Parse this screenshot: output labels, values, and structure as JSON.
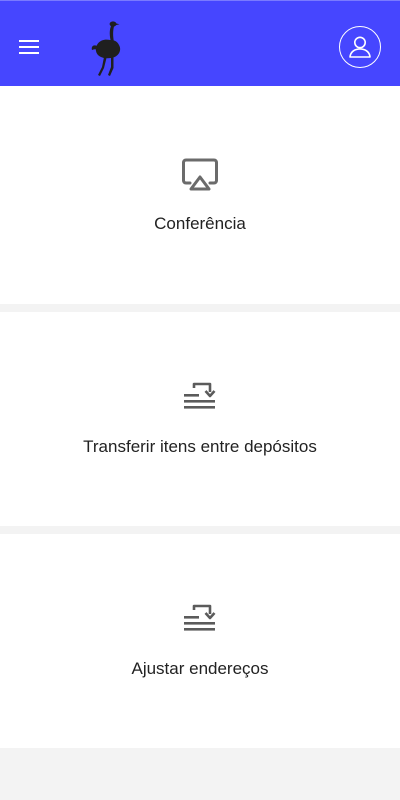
{
  "header": {
    "menu_icon": "hamburger-menu-icon",
    "logo_icon": "ostrich-logo-icon",
    "profile_icon": "user-profile-icon",
    "background_color": "#4646ff"
  },
  "menu": {
    "items": [
      {
        "label": "Conferência",
        "icon": "airplay-icon"
      },
      {
        "label": "Transferir itens entre depósitos",
        "icon": "transfer-list-icon"
      },
      {
        "label": "Ajustar endereços",
        "icon": "transfer-list-icon"
      }
    ]
  }
}
